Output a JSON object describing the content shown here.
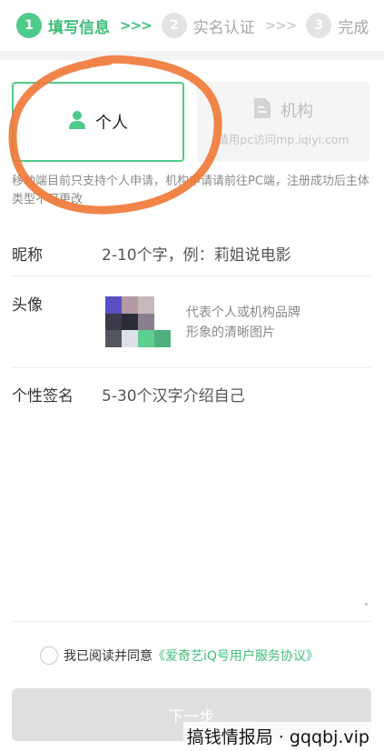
{
  "stepper": {
    "steps": [
      {
        "num": "1",
        "label": "填写信息",
        "state": "active"
      },
      {
        "num": "2",
        "label": "实名认证",
        "state": "inactive"
      },
      {
        "num": "3",
        "label": "完成",
        "state": "inactive"
      }
    ],
    "arrows": ">>>"
  },
  "account_type": {
    "personal": {
      "label": "个人",
      "icon": "person-icon",
      "selected": true
    },
    "organization": {
      "label": "机构",
      "icon": "document-icon",
      "hint": "请用pc访问mp.iqiyi.com",
      "disabled": true
    }
  },
  "notice": "移动端目前只支持个人申请，机构申请请前往PC端，注册成功后主体类型不可更改",
  "form": {
    "nickname": {
      "label": "昵称",
      "placeholder": "2-10个字，例：莉姐说电影"
    },
    "avatar": {
      "label": "头像",
      "hint_line1": "代表个人或机构品牌",
      "hint_line2": "形象的清晰图片"
    },
    "signature": {
      "label": "个性签名",
      "placeholder": "5-30个汉字介绍自己"
    }
  },
  "agreement": {
    "text": "我已阅读并同意",
    "link": "《爱奇艺iQ号用户服务协议》",
    "checked": false
  },
  "next_button": {
    "label": "下一步",
    "enabled": false
  },
  "watermark": "搞钱情报局 · gqqbj.vip",
  "colors": {
    "accent": "#3fbf7a",
    "annotation": "#f07a3a"
  }
}
